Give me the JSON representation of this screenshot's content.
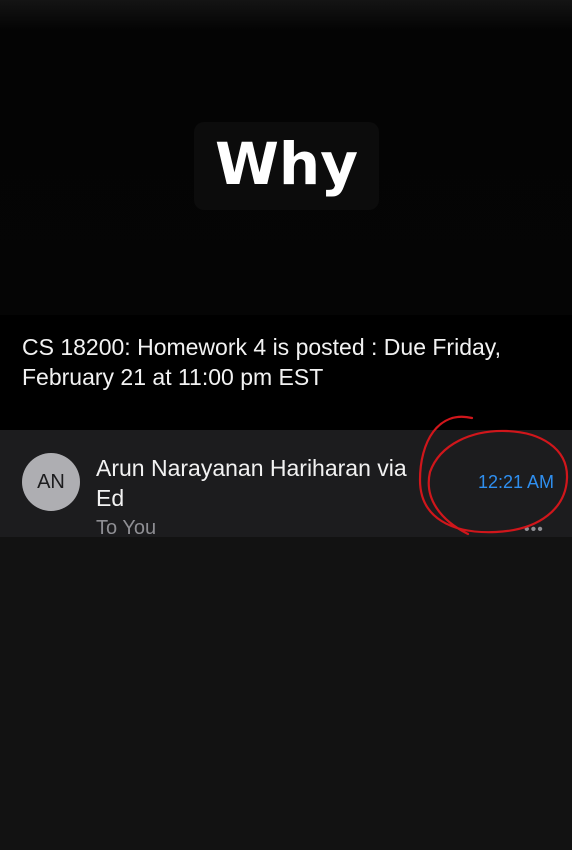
{
  "caption": {
    "text": "Why"
  },
  "email": {
    "subject": "CS 18200: Homework 4 is posted : Due Friday, February 21 at 11:00 pm EST",
    "avatar_initials": "AN",
    "sender": "Arun Narayanan Hariharan via Ed",
    "recipient": "To You",
    "time": "12:21 AM",
    "more_icon": "more-horizontal-icon"
  },
  "colors": {
    "background": "#121212",
    "email_row": "#1c1c1e",
    "time_accent": "#2f8ff0",
    "annotation_circle": "#d0161b"
  }
}
